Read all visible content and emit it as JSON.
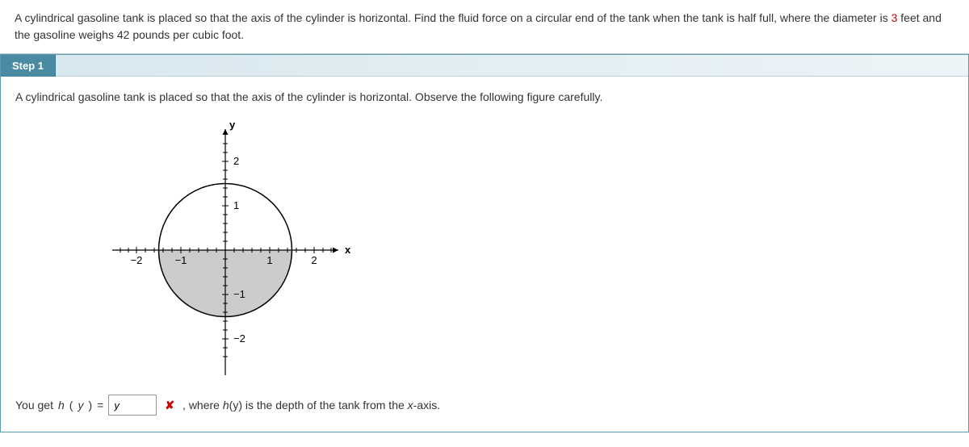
{
  "problem": {
    "textBefore": "A cylindrical gasoline tank is placed so that the axis of the cylinder is horizontal. Find the fluid force on a circular end of the tank when the tank is half full, where the diameter is ",
    "highlight": "3",
    "textAfter": " feet and the gasoline weighs 42 pounds per cubic foot."
  },
  "step": {
    "label": "Step 1",
    "intro": "A cylindrical gasoline tank is placed so that the axis of the cylinder is horizontal. Observe the following figure carefully."
  },
  "chart_data": {
    "type": "diagram",
    "title": "",
    "xlabel": "x",
    "ylabel": "y",
    "xlim": [
      -2.5,
      2.5
    ],
    "ylim": [
      -2.5,
      2.5
    ],
    "xticks": [
      -2,
      -1,
      1,
      2
    ],
    "yticks": [
      -2,
      -1,
      1,
      2
    ],
    "shapes": [
      {
        "type": "circle",
        "center": [
          0,
          0
        ],
        "radius": 1.5,
        "filled_region": "y <= 0 (shaded lower half)"
      }
    ],
    "description": "Circle of radius 1.5 centered at origin; bottom semicircle (y from -1.5 to 0) is shaded gray representing fluid."
  },
  "answer": {
    "prefix": "You get ",
    "funcName": "h",
    "funcArg": "y",
    "equals": " = ",
    "inputValue": "y",
    "suffixBefore": ", where ",
    "suffixItalic1": "h",
    "suffixArg": "(y)",
    "suffixAfter1": " is the depth of the tank from the ",
    "suffixItalic2": "x",
    "suffixAfter2": "-axis."
  }
}
